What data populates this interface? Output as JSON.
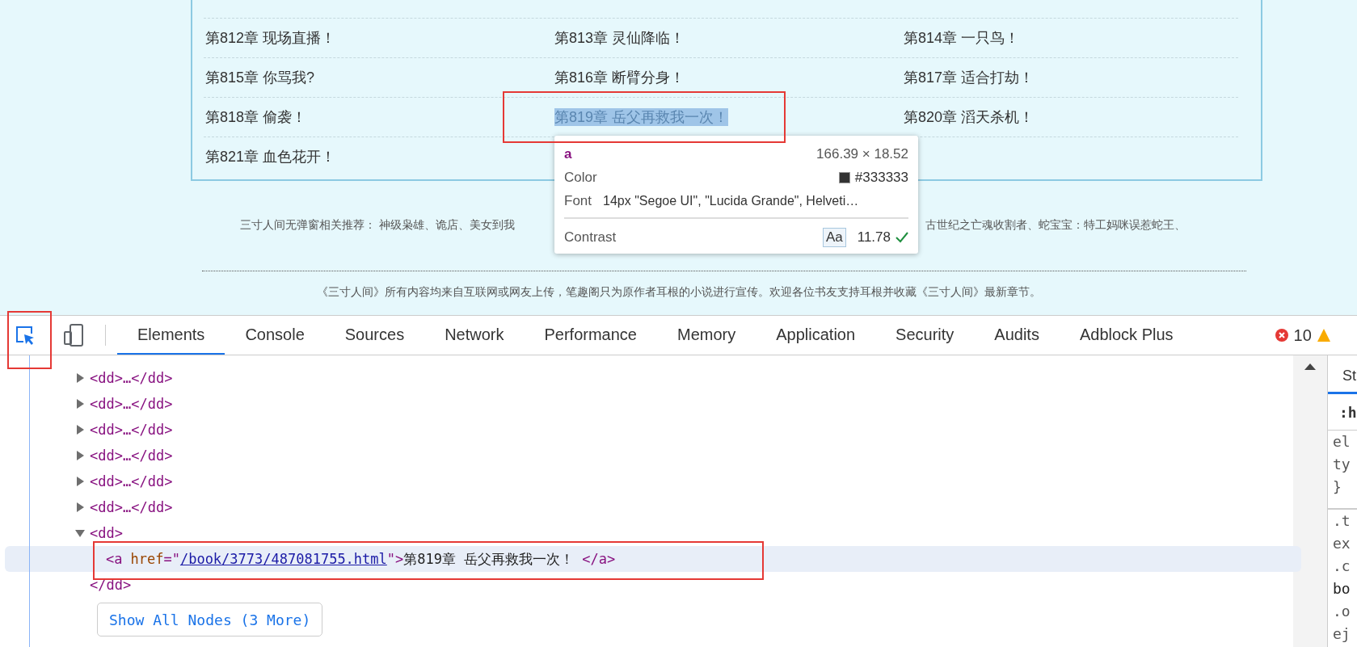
{
  "chapters": [
    {
      "title": "第812章 现场直播！",
      "selected": false
    },
    {
      "title": "第813章 灵仙降临！",
      "selected": false
    },
    {
      "title": "第814章 一只鸟！",
      "selected": false
    },
    {
      "title": "第815章 你骂我?",
      "selected": false
    },
    {
      "title": "第816章 断臂分身！",
      "selected": false
    },
    {
      "title": "第817章 适合打劫！",
      "selected": false
    },
    {
      "title": "第818章 偷袭！",
      "selected": false
    },
    {
      "title": "第819章 岳父再救我一次！",
      "selected": true
    },
    {
      "title": "第820章 滔天杀机！",
      "selected": false
    },
    {
      "title": "第821章 血色花开！",
      "selected": false
    }
  ],
  "tooltip": {
    "tag": "a",
    "size": "166.39 × 18.52",
    "color_label": "Color",
    "color_value": "#333333",
    "font_label": "Font",
    "font_value": "14px \"Segoe UI\", \"Lucida Grande\", Helveti…",
    "contrast_label": "Contrast",
    "contrast_sample": "Aa",
    "contrast_value": "11.78"
  },
  "recommend": {
    "left": "三寸人间无弹窗相关推荐：  神级枭雄、诡店、美女到我",
    "right": "古世纪之亡魂收割者、蛇宝宝：特工妈咪误惹蛇王、"
  },
  "footer_note": "《三寸人间》所有内容均来自互联网或网友上传，笔趣阁只为原作者耳根的小说进行宣传。欢迎各位书友支持耳根并收藏《三寸人间》最新章节。",
  "devtools": {
    "tabs": [
      {
        "label": "Elements",
        "selected": true
      },
      {
        "label": "Console",
        "selected": false
      },
      {
        "label": "Sources",
        "selected": false
      },
      {
        "label": "Network",
        "selected": false
      },
      {
        "label": "Performance",
        "selected": false
      },
      {
        "label": "Memory",
        "selected": false
      },
      {
        "label": "Application",
        "selected": false
      },
      {
        "label": "Security",
        "selected": false
      },
      {
        "label": "Audits",
        "selected": false
      },
      {
        "label": "Adblock Plus",
        "selected": false
      }
    ],
    "errors": "10",
    "tree": [
      {
        "open": "<dd>",
        "ellipsis": "…",
        "close": "</dd>",
        "expanded": false
      },
      {
        "open": "<dd>",
        "ellipsis": "…",
        "close": "</dd>",
        "expanded": false
      },
      {
        "open": "<dd>",
        "ellipsis": "…",
        "close": "</dd>",
        "expanded": false
      },
      {
        "open": "<dd>",
        "ellipsis": "…",
        "close": "</dd>",
        "expanded": false
      },
      {
        "open": "<dd>",
        "ellipsis": "…",
        "close": "</dd>",
        "expanded": false
      },
      {
        "open": "<dd>",
        "ellipsis": "…",
        "close": "</dd>",
        "expanded": false
      },
      {
        "open": "<dd>",
        "close": "</dd>",
        "expanded": true,
        "children": [
          {
            "tag": "<a",
            "attr": "href",
            "eq": "=\"",
            "value": "/book/3773/487081755.html",
            "quote": "\">",
            "text": "第819章 岳父再救我一次！",
            "end": "</a>",
            "selected": true
          }
        ]
      }
    ],
    "show_all": "Show All Nodes (3 More)",
    "styles_tab": "St",
    "styles_filter": ":h",
    "styles_lines": [
      "el",
      "ty",
      "}",
      ".t",
      "ex",
      ".c",
      "bo",
      ".o",
      "ej"
    ]
  }
}
